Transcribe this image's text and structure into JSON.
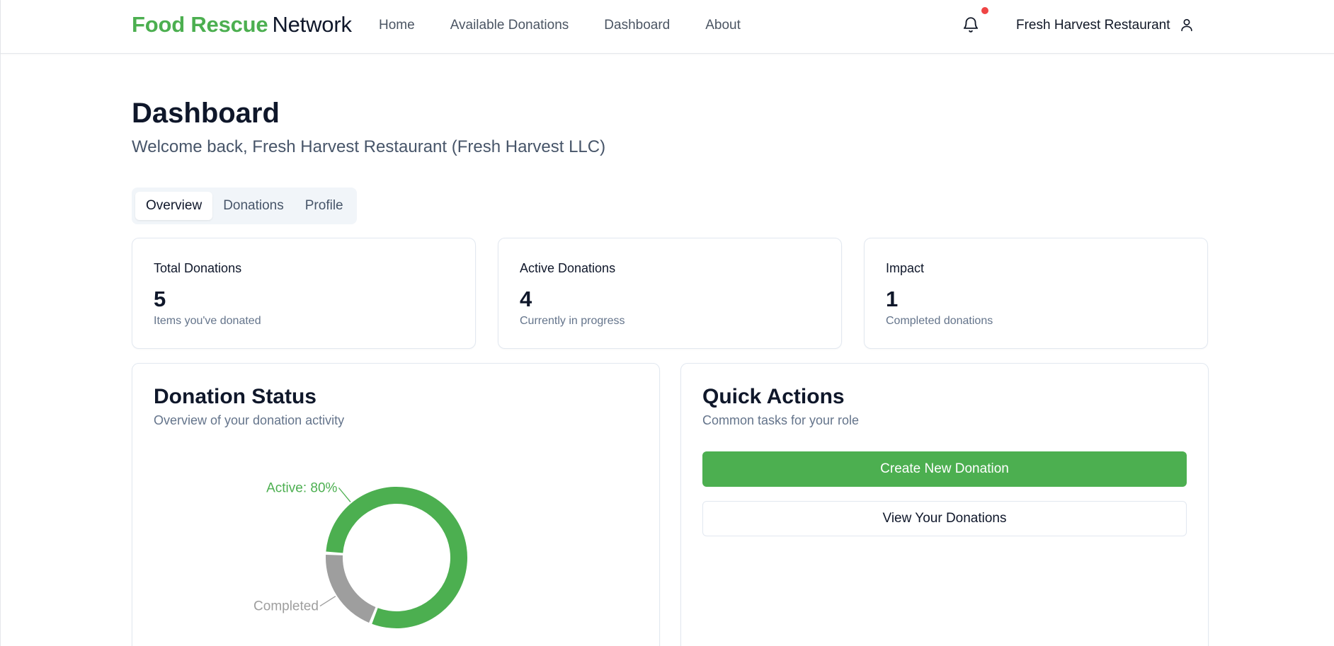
{
  "brand": {
    "part1": "Food Rescue",
    "part2": "Network",
    "accent_color": "#4caf50"
  },
  "nav": {
    "items": [
      "Home",
      "Available Donations",
      "Dashboard",
      "About"
    ]
  },
  "header_right": {
    "notification_icon": "bell-icon",
    "has_unread": true,
    "user_name": "Fresh Harvest Restaurant",
    "user_icon": "user-icon"
  },
  "page": {
    "title": "Dashboard",
    "welcome": "Welcome back, Fresh Harvest Restaurant (Fresh Harvest LLC)"
  },
  "tabs": [
    {
      "label": "Overview",
      "active": true
    },
    {
      "label": "Donations",
      "active": false
    },
    {
      "label": "Profile",
      "active": false
    }
  ],
  "stats": [
    {
      "label": "Total Donations",
      "value": "5",
      "sub": "Items you've donated"
    },
    {
      "label": "Active Donations",
      "value": "4",
      "sub": "Currently in progress"
    },
    {
      "label": "Impact",
      "value": "1",
      "sub": "Completed donations"
    }
  ],
  "status_card": {
    "title": "Donation Status",
    "desc": "Overview of your donation activity"
  },
  "quick_actions": {
    "title": "Quick Actions",
    "desc": "Common tasks for your role",
    "primary_label": "Create New Donation",
    "secondary_label": "View Your Donations"
  },
  "chart_data": {
    "type": "pie",
    "donut": true,
    "title": "",
    "slices": [
      {
        "name": "Active",
        "value": 80,
        "color": "#4caf50",
        "label": "Active: 80%"
      },
      {
        "name": "Completed",
        "value": 20,
        "color": "#9e9e9e",
        "label": "Completed"
      }
    ]
  }
}
